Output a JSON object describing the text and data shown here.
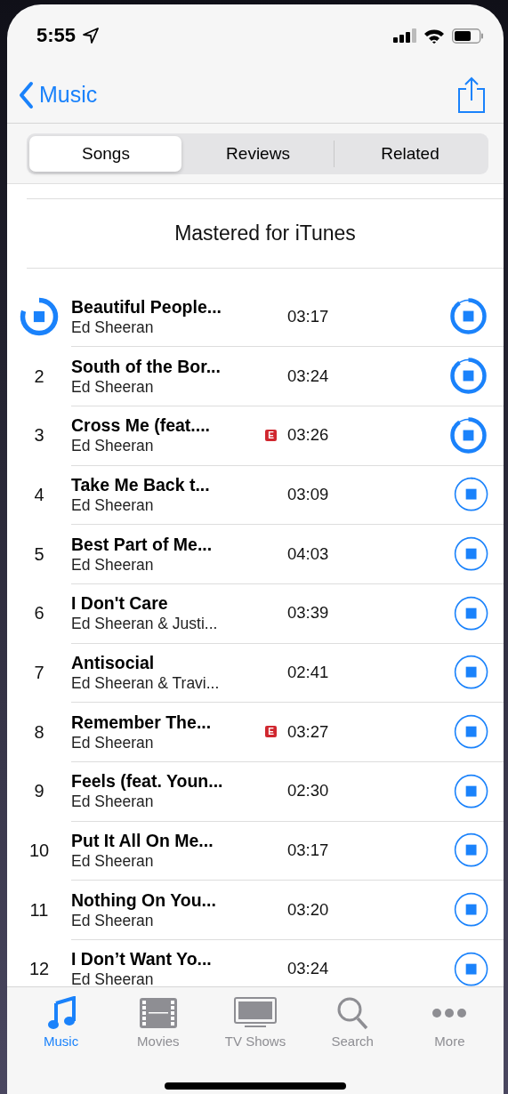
{
  "status_bar": {
    "time": "5:55"
  },
  "nav": {
    "back": "Music"
  },
  "segments": [
    {
      "label": "Songs",
      "selected": true
    },
    {
      "label": "Reviews",
      "selected": false
    },
    {
      "label": "Related",
      "selected": false
    }
  ],
  "section_title": "Mastered for iTunes",
  "tracks": [
    {
      "lead": {
        "level": 0.8
      },
      "title": "Beautiful People...",
      "artist": "Ed Sheeran",
      "explicit": false,
      "duration": "03:17",
      "download": {
        "level": 0.9
      }
    },
    {
      "number": "2",
      "title": "South of the Bor...",
      "artist": "Ed Sheeran",
      "explicit": false,
      "duration": "03:24",
      "download": {
        "level": 0.9
      }
    },
    {
      "number": "3",
      "title": "Cross Me (feat....",
      "artist": "Ed Sheeran",
      "explicit": true,
      "badge": "E",
      "duration": "03:26",
      "download": {
        "level": 0.9
      }
    },
    {
      "number": "4",
      "title": "Take Me Back t...",
      "artist": "Ed Sheeran",
      "explicit": false,
      "duration": "03:09",
      "download": {
        "level": 0.02
      }
    },
    {
      "number": "5",
      "title": "Best Part of Me...",
      "artist": "Ed Sheeran",
      "explicit": false,
      "duration": "04:03",
      "download": {
        "level": 0
      }
    },
    {
      "number": "6",
      "title": "I Don't Care",
      "artist": "Ed Sheeran & Justi...",
      "explicit": false,
      "duration": "03:39",
      "download": {
        "level": 0
      }
    },
    {
      "number": "7",
      "title": "Antisocial",
      "artist": "Ed Sheeran & Travi...",
      "explicit": false,
      "duration": "02:41",
      "download": {
        "level": 0
      }
    },
    {
      "number": "8",
      "title": "Remember The...",
      "artist": "Ed Sheeran",
      "explicit": true,
      "badge": "E",
      "duration": "03:27",
      "download": {
        "level": 0
      }
    },
    {
      "number": "9",
      "title": "Feels (feat. Youn...",
      "artist": "Ed Sheeran",
      "explicit": false,
      "duration": "02:30",
      "download": {
        "level": 0
      }
    },
    {
      "number": "10",
      "title": "Put It All On Me...",
      "artist": "Ed Sheeran",
      "explicit": false,
      "duration": "03:17",
      "download": {
        "level": 0
      }
    },
    {
      "number": "11",
      "title": "Nothing On You...",
      "artist": "Ed Sheeran",
      "explicit": false,
      "duration": "03:20",
      "download": {
        "level": 0
      }
    },
    {
      "number": "12",
      "title": "I Don’t Want Yo...",
      "artist": "Ed Sheeran",
      "explicit": false,
      "duration": "03:24",
      "download": {
        "level": 0
      }
    }
  ],
  "tab_bar": [
    {
      "kind": "music",
      "label": "Music",
      "selected": true
    },
    {
      "kind": "movies",
      "label": "Movies",
      "selected": false
    },
    {
      "kind": "tv",
      "label": "TV Shows",
      "selected": false
    },
    {
      "kind": "search",
      "label": "Search",
      "selected": false
    },
    {
      "kind": "more",
      "label": "More",
      "selected": false
    }
  ]
}
